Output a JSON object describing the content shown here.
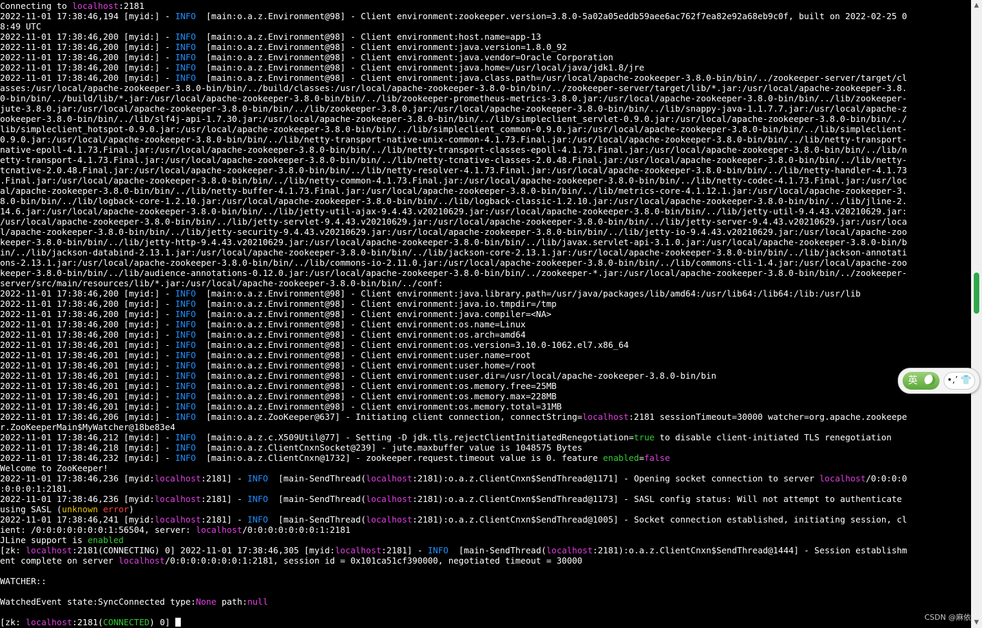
{
  "terminal": {
    "lines": [
      [
        [
          "Connecting to ",
          ""
        ],
        [
          "localhost",
          "c-mag"
        ],
        [
          ":2181",
          ""
        ]
      ],
      [
        [
          "2022-11-01 17:38:46,194 [myid:] - ",
          ""
        ],
        [
          "INFO",
          "c-blue"
        ],
        [
          "  [main:o.a.z.Environment@98] - Client environment:zookeeper.version=3.8.0-5a02a05eddb59aee6ac762f7ea82e92a68eb9c0f, built on 2022-02-25 0",
          ""
        ]
      ],
      [
        [
          "8:49 UTC",
          ""
        ]
      ],
      [
        [
          "2022-11-01 17:38:46,200 [myid:] - ",
          ""
        ],
        [
          "INFO",
          "c-blue"
        ],
        [
          "  [main:o.a.z.Environment@98] - Client environment:host.name=app-13",
          ""
        ]
      ],
      [
        [
          "2022-11-01 17:38:46,200 [myid:] - ",
          ""
        ],
        [
          "INFO",
          "c-blue"
        ],
        [
          "  [main:o.a.z.Environment@98] - Client environment:java.version=1.8.0_92",
          ""
        ]
      ],
      [
        [
          "2022-11-01 17:38:46,200 [myid:] - ",
          ""
        ],
        [
          "INFO",
          "c-blue"
        ],
        [
          "  [main:o.a.z.Environment@98] - Client environment:java.vendor=Oracle Corporation",
          ""
        ]
      ],
      [
        [
          "2022-11-01 17:38:46,200 [myid:] - ",
          ""
        ],
        [
          "INFO",
          "c-blue"
        ],
        [
          "  [main:o.a.z.Environment@98] - Client environment:java.home=/usr/local/java/jdk1.8/jre",
          ""
        ]
      ],
      [
        [
          "2022-11-01 17:38:46,200 [myid:] - ",
          ""
        ],
        [
          "INFO",
          "c-blue"
        ],
        [
          "  [main:o.a.z.Environment@98] - Client environment:java.class.path=/usr/local/apache-zookeeper-3.8.0-bin/bin/../zookeeper-server/target/cl",
          ""
        ]
      ],
      [
        [
          "asses:/usr/local/apache-zookeeper-3.8.0-bin/bin/../build/classes:/usr/local/apache-zookeeper-3.8.0-bin/bin/../zookeeper-server/target/lib/*.jar:/usr/local/apache-zookeeper-3.8.",
          ""
        ]
      ],
      [
        [
          "0-bin/bin/../build/lib/*.jar:/usr/local/apache-zookeeper-3.8.0-bin/bin/../lib/zookeeper-prometheus-metrics-3.8.0.jar:/usr/local/apache-zookeeper-3.8.0-bin/bin/../lib/zookeeper-",
          ""
        ]
      ],
      [
        [
          "jute-3.8.0.jar:/usr/local/apache-zookeeper-3.8.0-bin/bin/../lib/zookeeper-3.8.0.jar:/usr/local/apache-zookeeper-3.8.0-bin/bin/../lib/snappy-java-1.1.7.7.jar:/usr/local/apache-z",
          ""
        ]
      ],
      [
        [
          "ookeeper-3.8.0-bin/bin/../lib/slf4j-api-1.7.30.jar:/usr/local/apache-zookeeper-3.8.0-bin/bin/../lib/simpleclient_servlet-0.9.0.jar:/usr/local/apache-zookeeper-3.8.0-bin/bin/../",
          ""
        ]
      ],
      [
        [
          "lib/simpleclient_hotspot-0.9.0.jar:/usr/local/apache-zookeeper-3.8.0-bin/bin/../lib/simpleclient_common-0.9.0.jar:/usr/local/apache-zookeeper-3.8.0-bin/bin/../lib/simpleclient-",
          ""
        ]
      ],
      [
        [
          "0.9.0.jar:/usr/local/apache-zookeeper-3.8.0-bin/bin/../lib/netty-transport-native-unix-common-4.1.73.Final.jar:/usr/local/apache-zookeeper-3.8.0-bin/bin/../lib/netty-transport-",
          ""
        ]
      ],
      [
        [
          "native-epoll-4.1.73.Final.jar:/usr/local/apache-zookeeper-3.8.0-bin/bin/../lib/netty-transport-classes-epoll-4.1.73.Final.jar:/usr/local/apache-zookeeper-3.8.0-bin/bin/../lib/n",
          ""
        ]
      ],
      [
        [
          "etty-transport-4.1.73.Final.jar:/usr/local/apache-zookeeper-3.8.0-bin/bin/../lib/netty-tcnative-classes-2.0.48.Final.jar:/usr/local/apache-zookeeper-3.8.0-bin/bin/../lib/netty-",
          ""
        ]
      ],
      [
        [
          "tcnative-2.0.48.Final.jar:/usr/local/apache-zookeeper-3.8.0-bin/bin/../lib/netty-resolver-4.1.73.Final.jar:/usr/local/apache-zookeeper-3.8.0-bin/bin/../lib/netty-handler-4.1.73",
          ""
        ]
      ],
      [
        [
          ".Final.jar:/usr/local/apache-zookeeper-3.8.0-bin/bin/../lib/netty-common-4.1.73.Final.jar:/usr/local/apache-zookeeper-3.8.0-bin/bin/../lib/netty-codec-4.1.73.Final.jar:/usr/loc",
          ""
        ]
      ],
      [
        [
          "al/apache-zookeeper-3.8.0-bin/bin/../lib/netty-buffer-4.1.73.Final.jar:/usr/local/apache-zookeeper-3.8.0-bin/bin/../lib/metrics-core-4.1.12.1.jar:/usr/local/apache-zookeeper-3.",
          ""
        ]
      ],
      [
        [
          "8.0-bin/bin/../lib/logback-core-1.2.10.jar:/usr/local/apache-zookeeper-3.8.0-bin/bin/../lib/logback-classic-1.2.10.jar:/usr/local/apache-zookeeper-3.8.0-bin/bin/../lib/jline-2.",
          ""
        ]
      ],
      [
        [
          "14.6.jar:/usr/local/apache-zookeeper-3.8.0-bin/bin/../lib/jetty-util-ajax-9.4.43.v20210629.jar:/usr/local/apache-zookeeper-3.8.0-bin/bin/../lib/jetty-util-9.4.43.v20210629.jar:",
          ""
        ]
      ],
      [
        [
          "/usr/local/apache-zookeeper-3.8.0-bin/bin/../lib/jetty-servlet-9.4.43.v20210629.jar:/usr/local/apache-zookeeper-3.8.0-bin/bin/../lib/jetty-server-9.4.43.v20210629.jar:/usr/loca",
          ""
        ]
      ],
      [
        [
          "l/apache-zookeeper-3.8.0-bin/bin/../lib/jetty-security-9.4.43.v20210629.jar:/usr/local/apache-zookeeper-3.8.0-bin/bin/../lib/jetty-io-9.4.43.v20210629.jar:/usr/local/apache-zoo",
          ""
        ]
      ],
      [
        [
          "keeper-3.8.0-bin/bin/../lib/jetty-http-9.4.43.v20210629.jar:/usr/local/apache-zookeeper-3.8.0-bin/bin/../lib/javax.servlet-api-3.1.0.jar:/usr/local/apache-zookeeper-3.8.0-bin/b",
          ""
        ]
      ],
      [
        [
          "in/../lib/jackson-databind-2.13.1.jar:/usr/local/apache-zookeeper-3.8.0-bin/bin/../lib/jackson-core-2.13.1.jar:/usr/local/apache-zookeeper-3.8.0-bin/bin/../lib/jackson-annotati",
          ""
        ]
      ],
      [
        [
          "ons-2.13.1.jar:/usr/local/apache-zookeeper-3.8.0-bin/bin/../lib/commons-io-2.11.0.jar:/usr/local/apache-zookeeper-3.8.0-bin/bin/../lib/commons-cli-1.4.jar:/usr/local/apache-zoo",
          ""
        ]
      ],
      [
        [
          "keeper-3.8.0-bin/bin/../lib/audience-annotations-0.12.0.jar:/usr/local/apache-zookeeper-3.8.0-bin/bin/../zookeeper-*.jar:/usr/local/apache-zookeeper-3.8.0-bin/bin/../zookeeper-",
          ""
        ]
      ],
      [
        [
          "server/src/main/resources/lib/*.jar:/usr/local/apache-zookeeper-3.8.0-bin/bin/../conf:",
          ""
        ]
      ],
      [
        [
          "2022-11-01 17:38:46,200 [myid:] - ",
          ""
        ],
        [
          "INFO",
          "c-blue"
        ],
        [
          "  [main:o.a.z.Environment@98] - Client environment:java.library.path=/usr/java/packages/lib/amd64:/usr/lib64:/lib64:/lib:/usr/lib",
          ""
        ]
      ],
      [
        [
          "2022-11-01 17:38:46,200 [myid:] - ",
          ""
        ],
        [
          "INFO",
          "c-blue"
        ],
        [
          "  [main:o.a.z.Environment@98] - Client environment:java.io.tmpdir=/tmp",
          ""
        ]
      ],
      [
        [
          "2022-11-01 17:38:46,200 [myid:] - ",
          ""
        ],
        [
          "INFO",
          "c-blue"
        ],
        [
          "  [main:o.a.z.Environment@98] - Client environment:java.compiler=<NA>",
          ""
        ]
      ],
      [
        [
          "2022-11-01 17:38:46,200 [myid:] - ",
          ""
        ],
        [
          "INFO",
          "c-blue"
        ],
        [
          "  [main:o.a.z.Environment@98] - Client environment:os.name=Linux",
          ""
        ]
      ],
      [
        [
          "2022-11-01 17:38:46,200 [myid:] - ",
          ""
        ],
        [
          "INFO",
          "c-blue"
        ],
        [
          "  [main:o.a.z.Environment@98] - Client environment:os.arch=amd64",
          ""
        ]
      ],
      [
        [
          "2022-11-01 17:38:46,201 [myid:] - ",
          ""
        ],
        [
          "INFO",
          "c-blue"
        ],
        [
          "  [main:o.a.z.Environment@98] - Client environment:os.version=3.10.0-1062.el7.x86_64",
          ""
        ]
      ],
      [
        [
          "2022-11-01 17:38:46,201 [myid:] - ",
          ""
        ],
        [
          "INFO",
          "c-blue"
        ],
        [
          "  [main:o.a.z.Environment@98] - Client environment:user.name=root",
          ""
        ]
      ],
      [
        [
          "2022-11-01 17:38:46,201 [myid:] - ",
          ""
        ],
        [
          "INFO",
          "c-blue"
        ],
        [
          "  [main:o.a.z.Environment@98] - Client environment:user.home=/root",
          ""
        ]
      ],
      [
        [
          "2022-11-01 17:38:46,201 [myid:] - ",
          ""
        ],
        [
          "INFO",
          "c-blue"
        ],
        [
          "  [main:o.a.z.Environment@98] - Client environment:user.dir=/usr/local/apache-zookeeper-3.8.0-bin/bin",
          ""
        ]
      ],
      [
        [
          "2022-11-01 17:38:46,201 [myid:] - ",
          ""
        ],
        [
          "INFO",
          "c-blue"
        ],
        [
          "  [main:o.a.z.Environment@98] - Client environment:os.memory.free=25MB",
          ""
        ]
      ],
      [
        [
          "2022-11-01 17:38:46,201 [myid:] - ",
          ""
        ],
        [
          "INFO",
          "c-blue"
        ],
        [
          "  [main:o.a.z.Environment@98] - Client environment:os.memory.max=228MB",
          ""
        ]
      ],
      [
        [
          "2022-11-01 17:38:46,201 [myid:] - ",
          ""
        ],
        [
          "INFO",
          "c-blue"
        ],
        [
          "  [main:o.a.z.Environment@98] - Client environment:os.memory.total=31MB",
          ""
        ]
      ],
      [
        [
          "2022-11-01 17:38:46,206 [myid:] - ",
          ""
        ],
        [
          "INFO",
          "c-blue"
        ],
        [
          "  [main:o.a.z.ZooKeeper@637] - Initiating client connection, connectString=",
          ""
        ],
        [
          "localhost",
          "c-mag"
        ],
        [
          ":2181 sessionTimeout=30000 watcher=org.apache.zookeepe",
          ""
        ]
      ],
      [
        [
          "r.ZooKeeperMain$MyWatcher@18be83e4",
          ""
        ]
      ],
      [
        [
          "2022-11-01 17:38:46,212 [myid:] - ",
          ""
        ],
        [
          "INFO",
          "c-blue"
        ],
        [
          "  [main:o.a.z.c.X509Util@77] - Setting -D jdk.tls.rejectClientInitiatedRenegotiation=",
          ""
        ],
        [
          "true",
          "c-grn"
        ],
        [
          " to disable client-initiated TLS renegotiation",
          ""
        ]
      ],
      [
        [
          "2022-11-01 17:38:46,218 [myid:] - ",
          ""
        ],
        [
          "INFO",
          "c-blue"
        ],
        [
          "  [main:o.a.z.ClientCnxnSocket@239] - jute.maxbuffer value is 1048575 Bytes",
          ""
        ]
      ],
      [
        [
          "2022-11-01 17:38:46,232 [myid:] - ",
          ""
        ],
        [
          "INFO",
          "c-blue"
        ],
        [
          "  [main:o.a.z.ClientCnxn@1732] - zookeeper.request.timeout value is 0. feature ",
          ""
        ],
        [
          "enabled",
          "c-grn"
        ],
        [
          "=",
          ""
        ],
        [
          "false",
          "c-mag"
        ]
      ],
      [
        [
          "Welcome to ZooKeeper!",
          ""
        ]
      ],
      [
        [
          "2022-11-01 17:38:46,236 [myid:",
          ""
        ],
        [
          "localhost",
          "c-mag"
        ],
        [
          ":2181] - ",
          ""
        ],
        [
          "INFO",
          "c-blue"
        ],
        [
          "  [main-SendThread(",
          ""
        ],
        [
          "localhost",
          "c-mag"
        ],
        [
          ":2181):o.a.z.ClientCnxn$SendThread@1171] - Opening socket connection to server ",
          ""
        ],
        [
          "localhost",
          "c-mag"
        ],
        [
          "/0:0:0:0",
          ""
        ]
      ],
      [
        [
          ":0:0:0:1:2181.",
          ""
        ]
      ],
      [
        [
          "2022-11-01 17:38:46,236 [myid:",
          ""
        ],
        [
          "localhost",
          "c-mag"
        ],
        [
          ":2181] - ",
          ""
        ],
        [
          "INFO",
          "c-blue"
        ],
        [
          "  [main-SendThread(",
          ""
        ],
        [
          "localhost",
          "c-mag"
        ],
        [
          ":2181):o.a.z.ClientCnxn$SendThread@1173] - SASL config status: Will not attempt to authenticate",
          ""
        ]
      ],
      [
        [
          "using SASL (",
          ""
        ],
        [
          "unknown",
          "c-yel"
        ],
        [
          " ",
          ""
        ],
        [
          "error",
          "c-red"
        ],
        [
          ")",
          ""
        ]
      ],
      [
        [
          "2022-11-01 17:38:46,241 [myid:",
          ""
        ],
        [
          "localhost",
          "c-mag"
        ],
        [
          ":2181] - ",
          ""
        ],
        [
          "INFO",
          "c-blue"
        ],
        [
          "  [main-SendThread(",
          ""
        ],
        [
          "localhost",
          "c-mag"
        ],
        [
          ":2181):o.a.z.ClientCnxn$SendThread@1005] - Socket connection established, initiating session, cl",
          ""
        ]
      ],
      [
        [
          "ient: /0:0:0:0:0:0:0:1:56504, server: ",
          ""
        ],
        [
          "localhost",
          "c-mag"
        ],
        [
          "/0:0:0:0:0:0:0:1:2181",
          ""
        ]
      ],
      [
        [
          "JLine support is ",
          ""
        ],
        [
          "enabled",
          "c-grn"
        ]
      ],
      [
        [
          "[zk: ",
          ""
        ],
        [
          "localhost",
          "c-mag"
        ],
        [
          ":2181(CONNECTING) 0] 2022-11-01 17:38:46,305 [myid:",
          ""
        ],
        [
          "localhost",
          "c-mag"
        ],
        [
          ":2181] - ",
          ""
        ],
        [
          "INFO",
          "c-blue"
        ],
        [
          "  [main-SendThread(",
          ""
        ],
        [
          "localhost",
          "c-mag"
        ],
        [
          ":2181):o.a.z.ClientCnxn$SendThread@1444] - Session establishm",
          ""
        ]
      ],
      [
        [
          "ent complete on server ",
          ""
        ],
        [
          "localhost",
          "c-mag"
        ],
        [
          "/0:0:0:0:0:0:0:1:2181, session id = 0x101ca51cf390000, negotiated timeout = 30000",
          ""
        ]
      ],
      [
        [
          "",
          ""
        ]
      ],
      [
        [
          "WATCHER::",
          ""
        ]
      ],
      [
        [
          "",
          ""
        ]
      ],
      [
        [
          "WatchedEvent state:SyncConnected type:",
          ""
        ],
        [
          "None",
          "c-mag"
        ],
        [
          " path:",
          ""
        ],
        [
          "null",
          "c-mag"
        ]
      ],
      [
        [
          "",
          ""
        ]
      ]
    ],
    "prompt": [
      [
        "[zk: ",
        ""
      ],
      [
        "localhost",
        "c-mag"
      ],
      [
        ":2181(",
        ""
      ],
      [
        "CONNECTED",
        "c-grn"
      ],
      [
        ") 0] ",
        ""
      ]
    ]
  },
  "ime": {
    "lang_label": "英",
    "tools_label": "•,’ 👕"
  },
  "watermark": "CSDN @麻依"
}
